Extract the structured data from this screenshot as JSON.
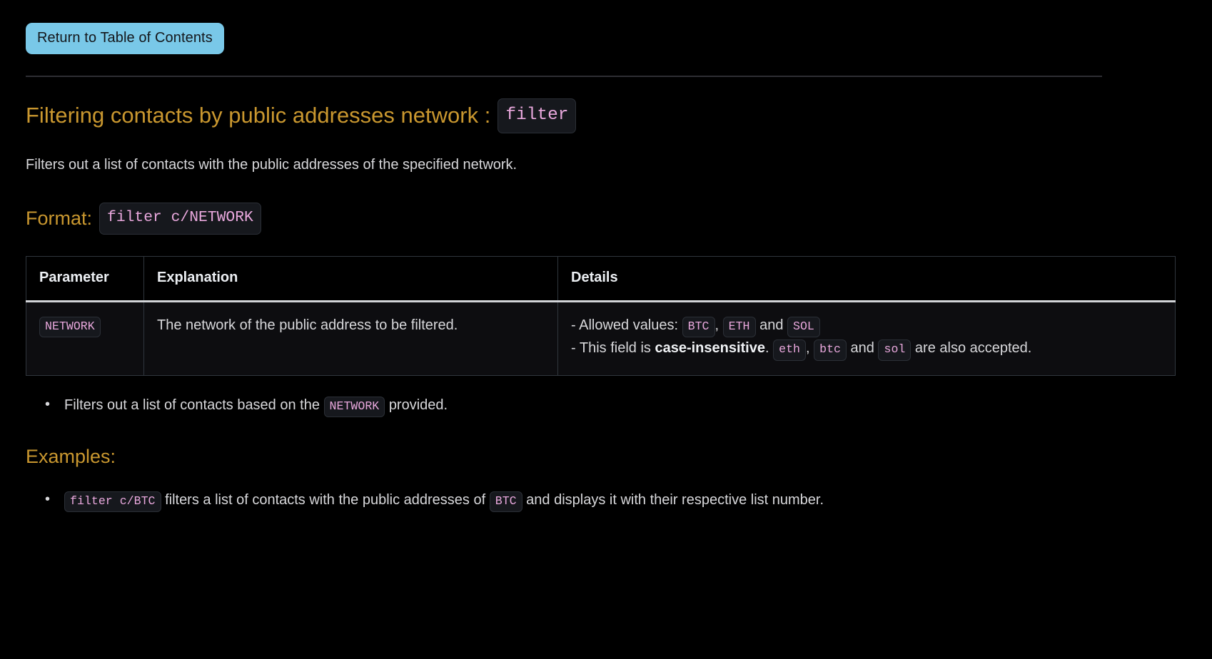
{
  "nav": {
    "return_button_label": "Return to Table of Contents"
  },
  "section": {
    "title_text": "Filtering contacts by public addresses network :",
    "title_code": "filter",
    "description": "Filters out a list of contacts with the public addresses of the specified network.",
    "format_label": "Format:",
    "format_code": "filter c/NETWORK"
  },
  "table": {
    "headers": [
      "Parameter",
      "Explanation",
      "Details"
    ],
    "rows": [
      {
        "parameter_code": "NETWORK",
        "explanation": "The network of the public address to be filtered.",
        "details": {
          "line1_prefix": "- Allowed values:",
          "line1_code1": "BTC",
          "line1_sep1": ",",
          "line1_code2": "ETH",
          "line1_sep2": "and",
          "line1_code3": "SOL",
          "line2_prefix": "- This field is",
          "line2_bold": "case-insensitive",
          "line2_after_bold": ".",
          "line2_code1": "eth",
          "line2_sep1": ",",
          "line2_code2": "btc",
          "line2_sep2": "and",
          "line2_code3": "sol",
          "line2_suffix": "are also accepted."
        }
      }
    ]
  },
  "notes": {
    "bullet1_before": "Filters out a list of contacts based on the",
    "bullet1_code": "NETWORK",
    "bullet1_after": "provided."
  },
  "examples": {
    "heading": "Examples:",
    "items": [
      {
        "code1": "filter c/BTC",
        "middle": "filters a list of contacts with the public addresses of",
        "code2": "BTC",
        "after": "and displays it with their respective list number."
      }
    ]
  },
  "colors": {
    "background": "#000000",
    "accent_heading": "#c9972f",
    "button_bg": "#79c8e8",
    "button_text": "#14161a",
    "code_text": "#e9a8dd",
    "code_bg": "#16181d",
    "body_text": "#d8d8db",
    "table_border": "#30363d",
    "header_divider": "#d2d4d8"
  }
}
